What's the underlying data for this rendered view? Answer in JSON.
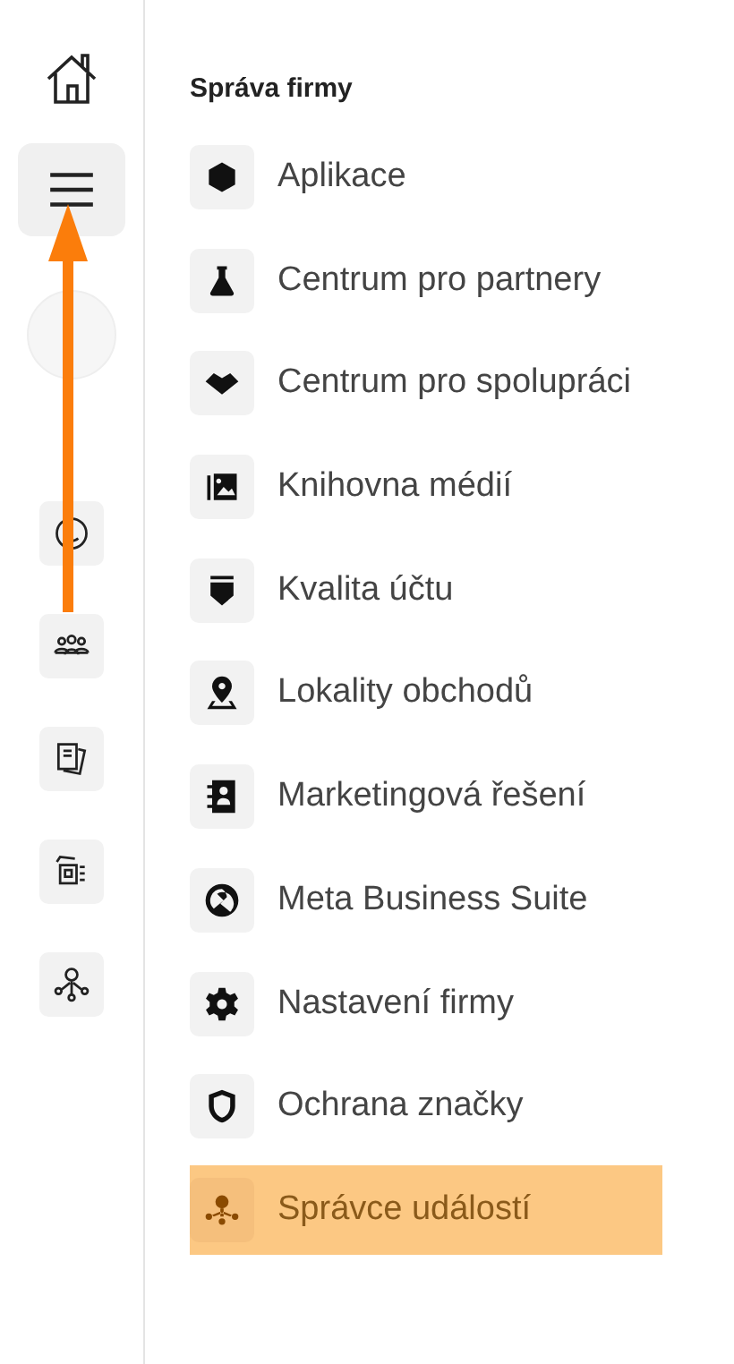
{
  "rail": {
    "menu_selected": true
  },
  "section": {
    "title": "Správa firmy",
    "items": [
      {
        "label": "Aplikace",
        "highlighted": false
      },
      {
        "label": "Centrum pro partnery",
        "highlighted": false
      },
      {
        "label": "Centrum pro spolupráci",
        "highlighted": false
      },
      {
        "label": "Knihovna médií",
        "highlighted": false
      },
      {
        "label": "Kvalita účtu",
        "highlighted": false
      },
      {
        "label": "Lokality obchodů",
        "highlighted": false
      },
      {
        "label": "Marketingová řešení",
        "highlighted": false
      },
      {
        "label": "Meta Business Suite",
        "highlighted": false
      },
      {
        "label": "Nastavení firmy",
        "highlighted": false
      },
      {
        "label": "Ochrana značky",
        "highlighted": false
      },
      {
        "label": "Správce událostí",
        "highlighted": true
      }
    ]
  }
}
